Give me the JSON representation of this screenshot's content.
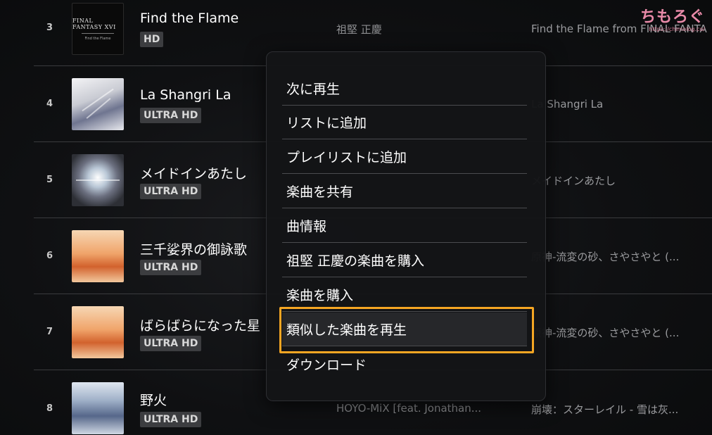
{
  "tracks": [
    {
      "num": "3",
      "title": "Find the Flame",
      "badge": "HD",
      "artist": "祖堅 正慶",
      "album": "Find the Flame from FINAL FANTASY XVI",
      "cover": "ff",
      "cover_lines": [
        "FINAL FANTASY XVI",
        "Find the Flame"
      ]
    },
    {
      "num": "4",
      "title": "La Shangri La",
      "badge": "ULTRA HD",
      "artist": "",
      "album": "La Shangri La",
      "cover": "ls"
    },
    {
      "num": "5",
      "title": "メイドインあたし",
      "badge": "ULTRA HD",
      "artist": "",
      "album": "メイドインあたし",
      "cover": "md"
    },
    {
      "num": "6",
      "title": "三千娑界の御詠歌",
      "badge": "ULTRA HD",
      "artist": "",
      "album": "原神-流変の砂、さやさやと (...",
      "cover": "gs"
    },
    {
      "num": "7",
      "title": "ばらばらになった星",
      "badge": "ULTRA HD",
      "artist": "",
      "album": "原神-流変の砂、さやさやと (...",
      "cover": "gs"
    },
    {
      "num": "8",
      "title": "野火",
      "badge": "ULTRA HD",
      "artist": "HOYO-MiX [feat. Jonathan...",
      "album": "崩壊：スターレイル - 雪は灰...",
      "cover": "hs"
    }
  ],
  "context_menu": {
    "items": [
      "次に再生",
      "リストに追加",
      "プレイリストに追加",
      "楽曲を共有",
      "曲情報",
      "祖堅 正慶の楽曲を購入",
      "楽曲を購入",
      "類似した楽曲を再生",
      "ダウンロード"
    ],
    "highlighted_index": 7
  },
  "watermark": {
    "logo": "ちもろぐ",
    "url": "https://chimolog.co/"
  },
  "colors": {
    "highlight_border": "#f5a623",
    "badge_bg": "#3c3d40",
    "background": "#0d0e10"
  }
}
